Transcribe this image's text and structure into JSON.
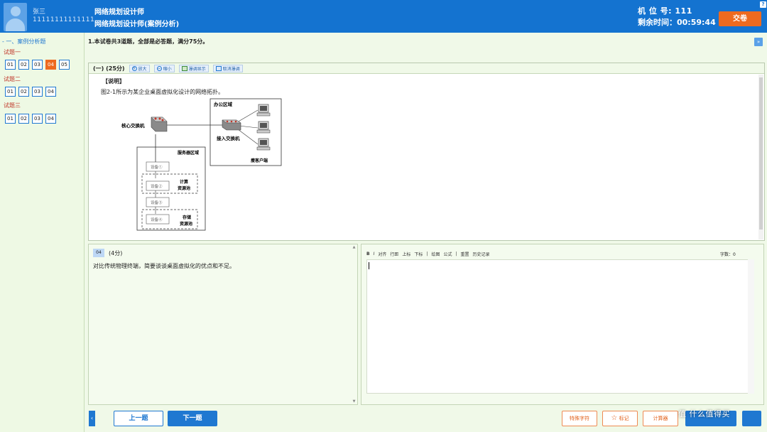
{
  "header": {
    "user_name": "张三",
    "user_id": "11111111111111",
    "exam_title": "网络规划设计师",
    "exam_subtitle": "网络规划设计师(案例分析)",
    "seat": "机 位 号: 111",
    "remaining_time": "剩余时间：00:59:44",
    "submit_label": "交卷",
    "help_label": "?"
  },
  "sidebar": {
    "section_title": "- 一、案例分析题",
    "groups": [
      {
        "label": "试题一",
        "items": [
          "01",
          "02",
          "03",
          "04",
          "05"
        ],
        "active": "04"
      },
      {
        "label": "试题二",
        "items": [
          "01",
          "02",
          "03",
          "04"
        ]
      },
      {
        "label": "试题三",
        "items": [
          "01",
          "02",
          "03",
          "04"
        ]
      }
    ]
  },
  "main": {
    "instruction": "1.本试卷共3道题，全部是必答题，满分75分。",
    "collapse_label": "»",
    "question_panel": {
      "section": "(一)  (25分)",
      "zoom_in": "放大",
      "zoom_out": "缩小",
      "split_view": "瀑调显示",
      "cancel_split": "取消瀑调",
      "label": "【说明】",
      "description": "图2-1所示为某企业桌面虚拟化设计的网络拓扑。"
    },
    "figure": {
      "core_switch": "核心交换机",
      "office_area": "办公区域",
      "access_switch": "接入交换机",
      "thin_client": "瘦客户端",
      "server_area": "服务器区域",
      "device1": "设备①",
      "device2": "设备②",
      "device3": "设备③",
      "device4": "设备④",
      "compute_pool_1": "计算",
      "compute_pool_2": "资源池",
      "storage_pool_1": "存储",
      "storage_pool_2": "资源池"
    },
    "subquestion": {
      "number": "04",
      "score": "(4分)",
      "text": "对比传统物理终端，简要谈谈桌面虚拟化的优点和不足。"
    },
    "answer": {
      "toolbar": [
        "B",
        "I",
        "对齐",
        "行距",
        "上标",
        "下标",
        "|",
        "绘图",
        "公式",
        "|",
        "重置",
        "历史记录"
      ],
      "word_count": "字数：0"
    }
  },
  "footer": {
    "prev_arrow": "‹",
    "prev": "上一题",
    "next": "下一题",
    "special_chars": "特殊字符",
    "mark": "标记",
    "calculator": "计算器",
    "watermark": "值 什么值得买"
  }
}
